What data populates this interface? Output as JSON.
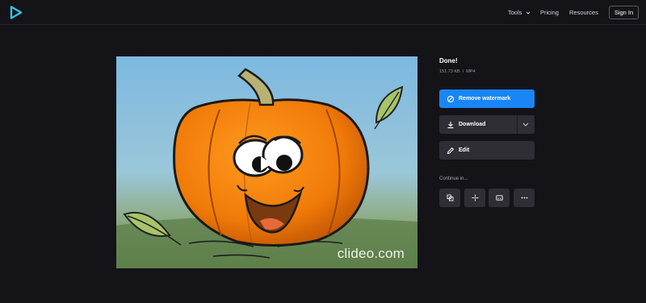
{
  "header": {
    "nav": {
      "tools": "Tools",
      "pricing": "Pricing",
      "resources": "Resources"
    },
    "signin": "Sign In"
  },
  "preview": {
    "watermark": "clideo.com"
  },
  "result": {
    "title": "Done!",
    "size": "151.73 KB",
    "separator": "/",
    "format": "MP4"
  },
  "actions": {
    "remove_watermark": "Remove watermark",
    "download": "Download",
    "edit": "Edit"
  },
  "continue": {
    "label": "Continue in...",
    "tools": [
      {
        "icon": "merge-icon"
      },
      {
        "icon": "crop-icon"
      },
      {
        "icon": "subtitles-icon"
      },
      {
        "icon": "more-icon"
      }
    ]
  },
  "colors": {
    "background": "#141318",
    "accent": "#1a86f5",
    "button": "#2f2e35"
  }
}
